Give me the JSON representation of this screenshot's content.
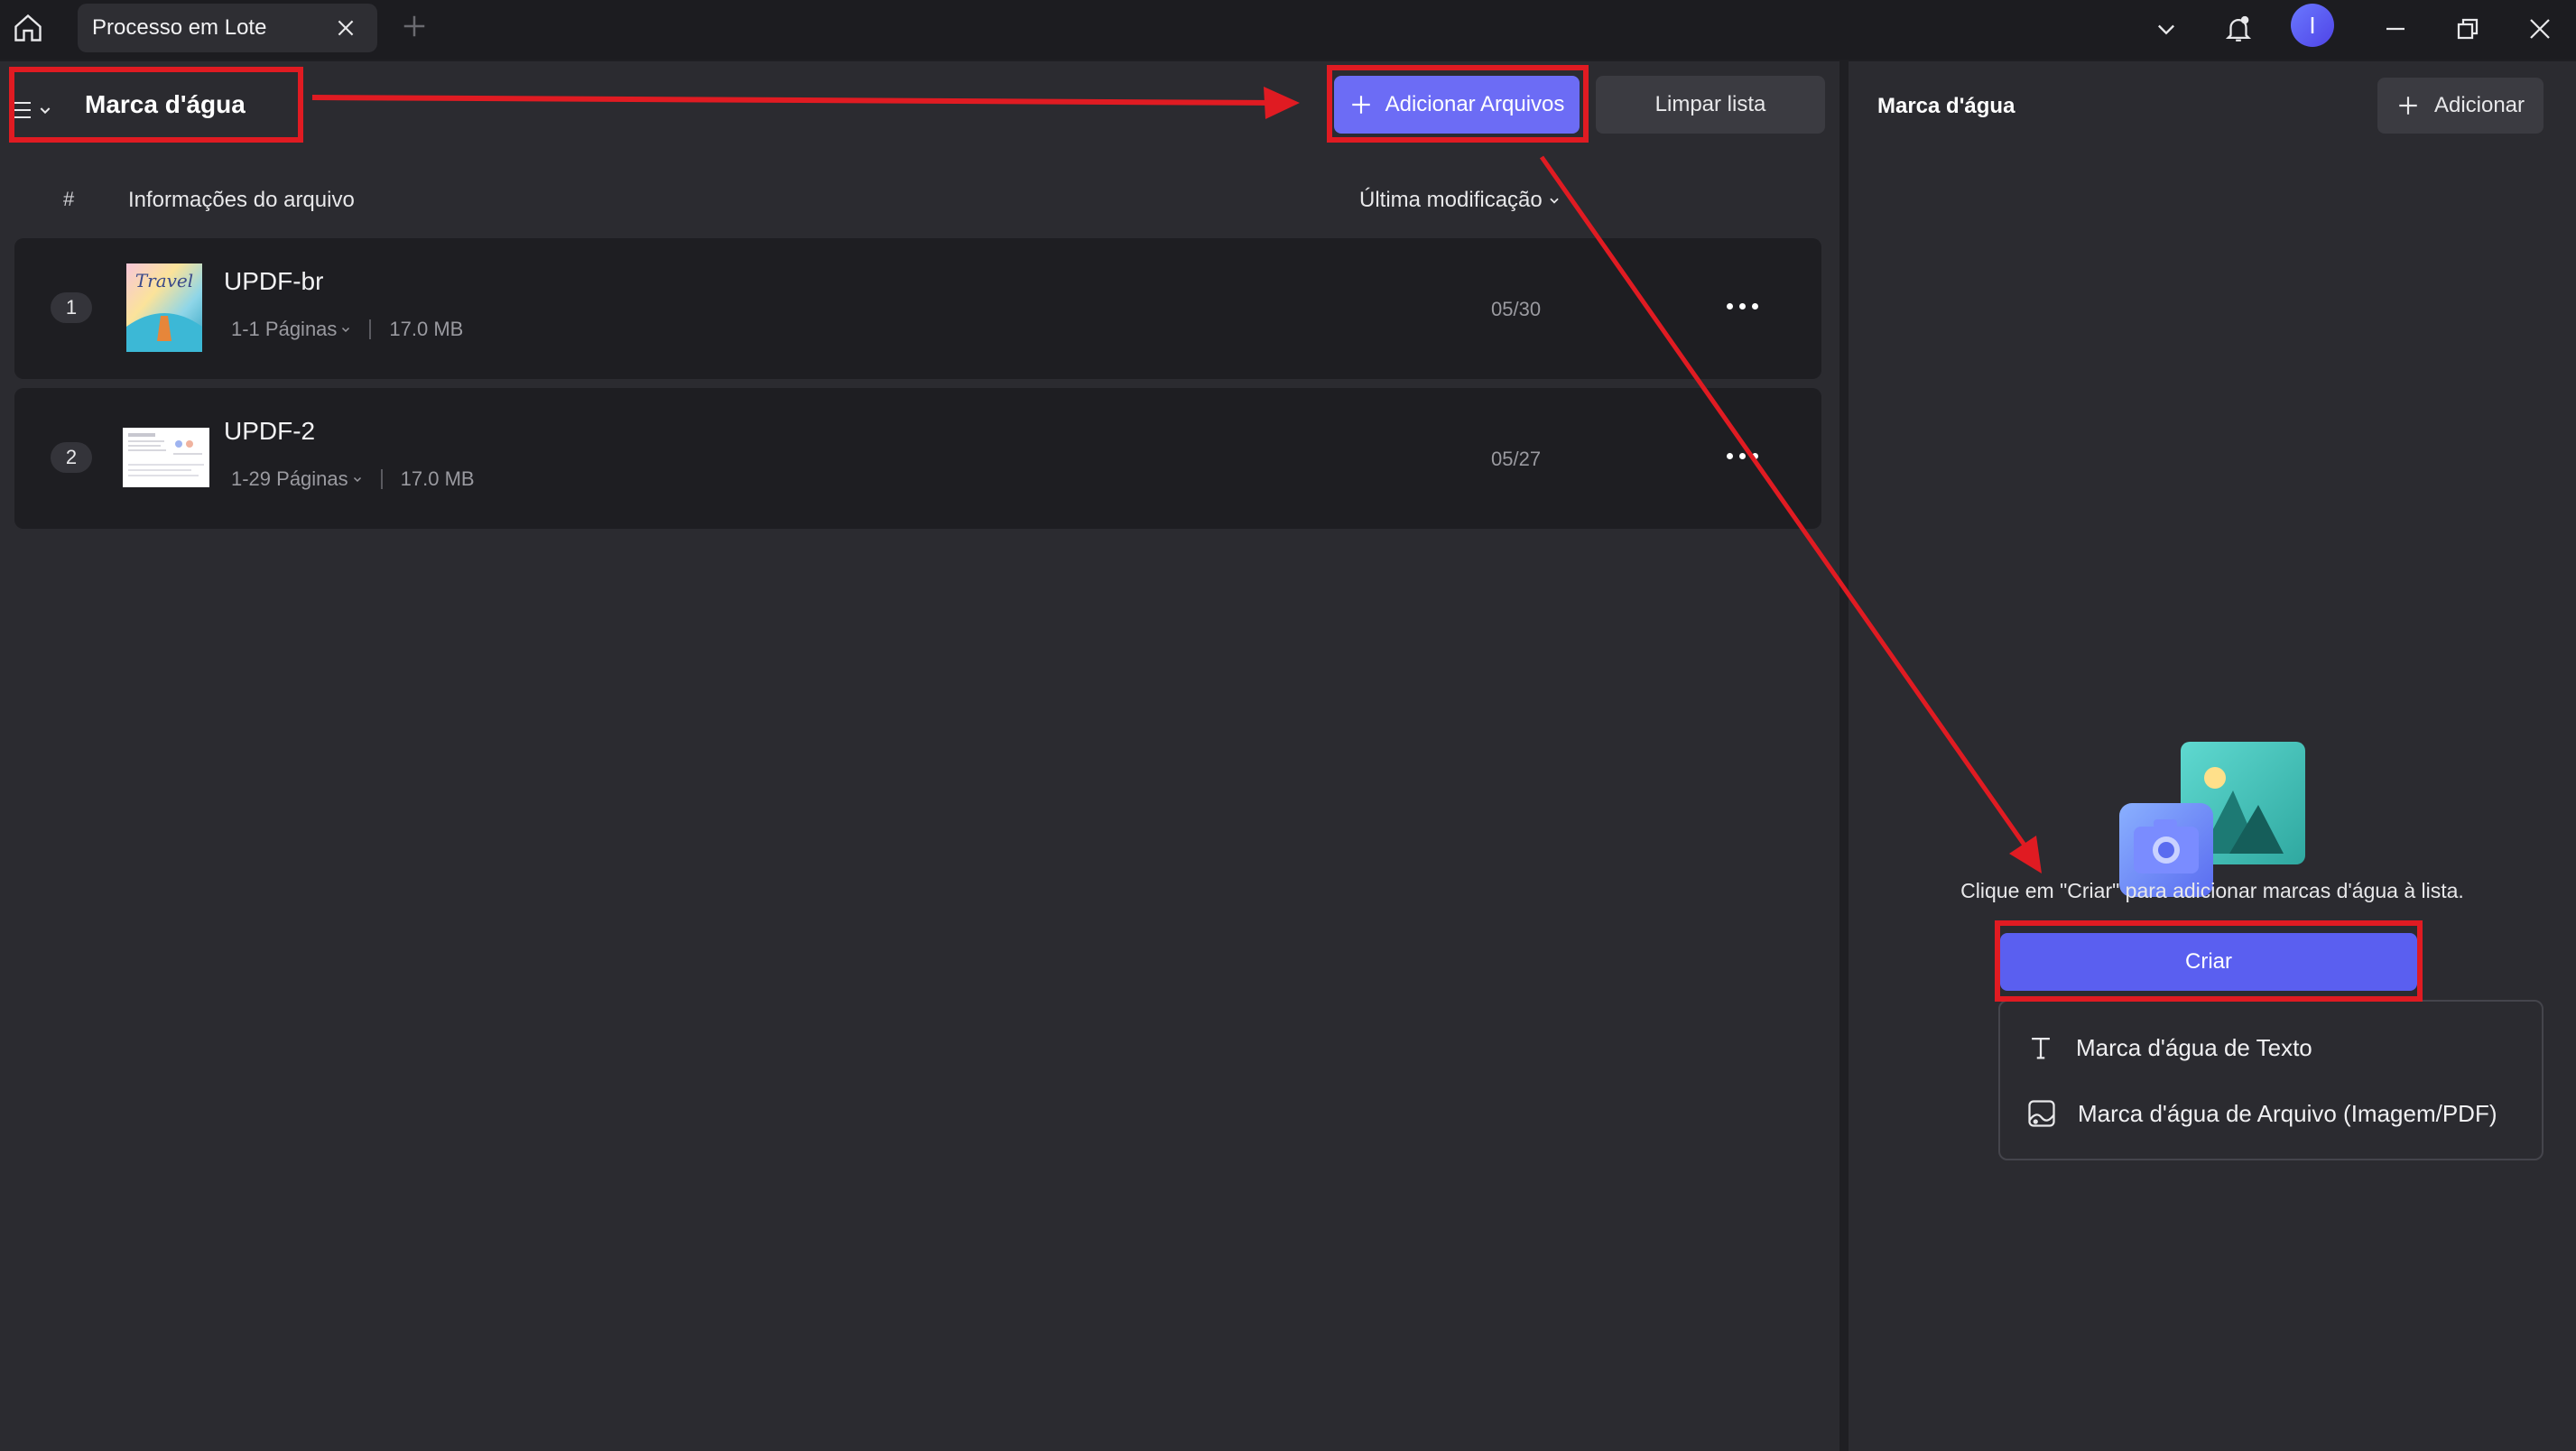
{
  "titlebar": {
    "tab_title": "Processo em Lote",
    "avatar_initial": "I"
  },
  "header": {
    "page_title": "Marca d'água",
    "add_files_label": "Adicionar Arquivos",
    "clear_list_label": "Limpar lista"
  },
  "table": {
    "col_hash": "#",
    "col_info": "Informações do arquivo",
    "col_modified": "Última modificação",
    "rows": [
      {
        "index": "1",
        "name": "UPDF-br",
        "pages": "1-1 Páginas",
        "size": "17.0 MB",
        "date": "05/30",
        "thumb_text": "Travel"
      },
      {
        "index": "2",
        "name": "UPDF-2",
        "pages": "1-29 Páginas",
        "size": "17.0 MB",
        "date": "05/27"
      }
    ]
  },
  "side": {
    "title": "Marca d'água",
    "add_label": "Adicionar",
    "empty_hint": "Clique em \"Criar\" para adicionar marcas d'água à lista.",
    "create_label": "Criar",
    "menu": [
      {
        "label": "Marca d'água de Texto",
        "icon": "text-icon"
      },
      {
        "label": "Marca d'água de Arquivo (Imagem/PDF)",
        "icon": "image-file-icon"
      }
    ]
  },
  "colors": {
    "accent": "#6c6cf5",
    "annotation": "#e01b22",
    "panel": "#2b2b30",
    "row": "#1e1e22"
  }
}
